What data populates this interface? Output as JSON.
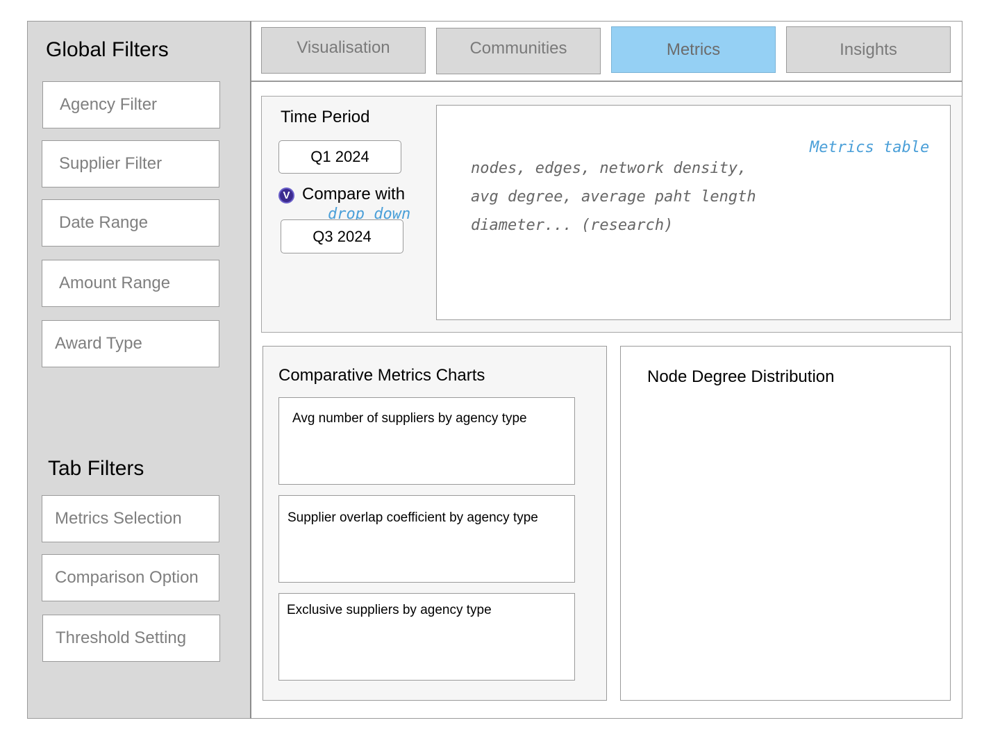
{
  "sidebar": {
    "global_title": "Global Filters",
    "global_filters": [
      "Agency Filter",
      "Supplier Filter",
      "Date Range",
      "Amount Range",
      "Award Type"
    ],
    "tab_title": "Tab Filters",
    "tab_filters": [
      "Metrics Selection",
      "Comparison Option",
      "Threshold Setting"
    ]
  },
  "tabs": [
    {
      "label": "Visualisation",
      "active": false
    },
    {
      "label": "Communities",
      "active": false
    },
    {
      "label": "Metrics",
      "active": true
    },
    {
      "label": "Insights",
      "active": false
    }
  ],
  "time_period": {
    "title": "Time Period",
    "period_value": "Q1 2024",
    "compare_checked": true,
    "checkbox_glyph": "V",
    "compare_label": "Compare with",
    "compare_value": "Q3 2024",
    "annotation": "drop down"
  },
  "metrics_table": {
    "annotation": "Metrics table",
    "lines": [
      "nodes, edges, network density,",
      "avg degree, average paht length",
      "diameter... (research)"
    ]
  },
  "comparative": {
    "title": "Comparative Metrics Charts",
    "charts": [
      "Avg number of suppliers by agency type",
      "Supplier overlap coefficient by agency type",
      "Exclusive suppliers by agency type"
    ]
  },
  "node_degree": {
    "title": "Node Degree Distribution"
  },
  "colors": {
    "sidebar_bg": "#d9d9d9",
    "tab_bg": "#d9d9d9",
    "active_tab_bg": "#95d0f4",
    "annotation_blue": "#4a9fd8",
    "checkbox": "#3b2a8f"
  }
}
